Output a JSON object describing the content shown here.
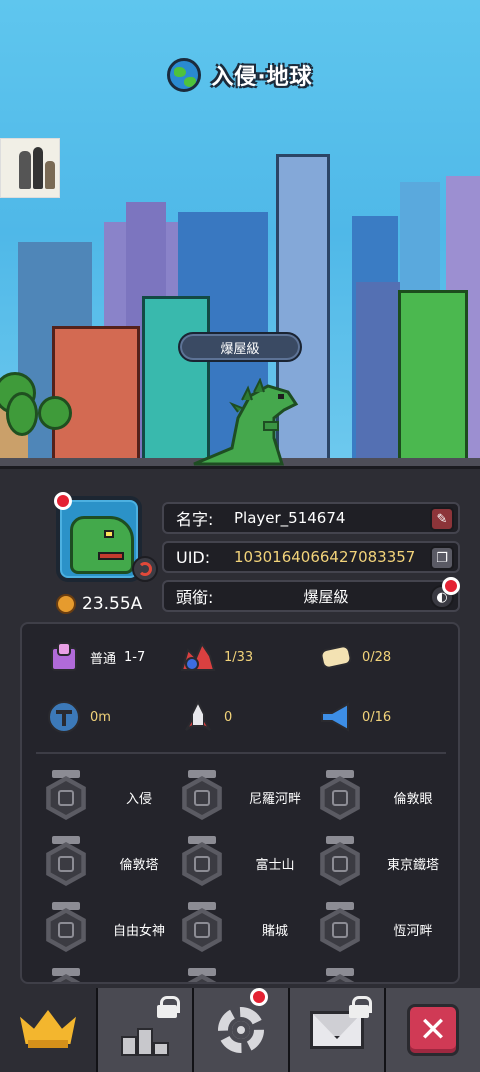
{
  "header": {
    "title": "入侵·地球"
  },
  "scene": {
    "rank_chip": "爆屋級"
  },
  "profile": {
    "power": "23.55A",
    "name_label": "名字:",
    "name_value": "Player_514674",
    "uid_label": "UID:",
    "uid_value": "1030164066427083357",
    "title_label": "頭銜:",
    "title_value": "爆屋級"
  },
  "stats": [
    {
      "icon": "trophy-stand-icon",
      "label": "普通",
      "value": "1-7"
    },
    {
      "icon": "monster-group-icon",
      "label": "",
      "value": "1/33"
    },
    {
      "icon": "scroll-icon",
      "label": "",
      "value": "0/28"
    },
    {
      "icon": "distance-icon",
      "label": "",
      "value": "0m"
    },
    {
      "icon": "rocket-icon",
      "label": "",
      "value": "0"
    },
    {
      "icon": "megaphone-icon",
      "label": "",
      "value": "0/16"
    }
  ],
  "badges": [
    {
      "name": "入侵",
      "icon": "globe-badge-icon"
    },
    {
      "name": "尼羅河畔",
      "icon": "pyramid-badge-icon"
    },
    {
      "name": "倫敦眼",
      "icon": "ferris-wheel-badge-icon"
    },
    {
      "name": "倫敦塔",
      "icon": "tower-badge-icon"
    },
    {
      "name": "富士山",
      "icon": "mountain-badge-icon"
    },
    {
      "name": "東京鐵塔",
      "icon": "tokyo-tower-badge-icon"
    },
    {
      "name": "自由女神",
      "icon": "statue-badge-icon"
    },
    {
      "name": "賭城",
      "icon": "casino-badge-icon"
    },
    {
      "name": "恆河畔",
      "icon": "temple-badge-icon"
    }
  ],
  "bottom_nav": [
    {
      "icon": "crown-icon",
      "state": "active",
      "locked": false
    },
    {
      "icon": "podium-icon",
      "state": "inactive",
      "locked": true
    },
    {
      "icon": "gear-icon",
      "state": "inactive",
      "locked": false,
      "notification": true
    },
    {
      "icon": "mail-icon",
      "state": "inactive",
      "locked": true
    },
    {
      "icon": "close-icon",
      "state": "inactive",
      "locked": false
    }
  ],
  "colors": {
    "accent_yellow": "#f2d37a",
    "notify_red": "#e42233",
    "close_red": "#d03a55"
  }
}
